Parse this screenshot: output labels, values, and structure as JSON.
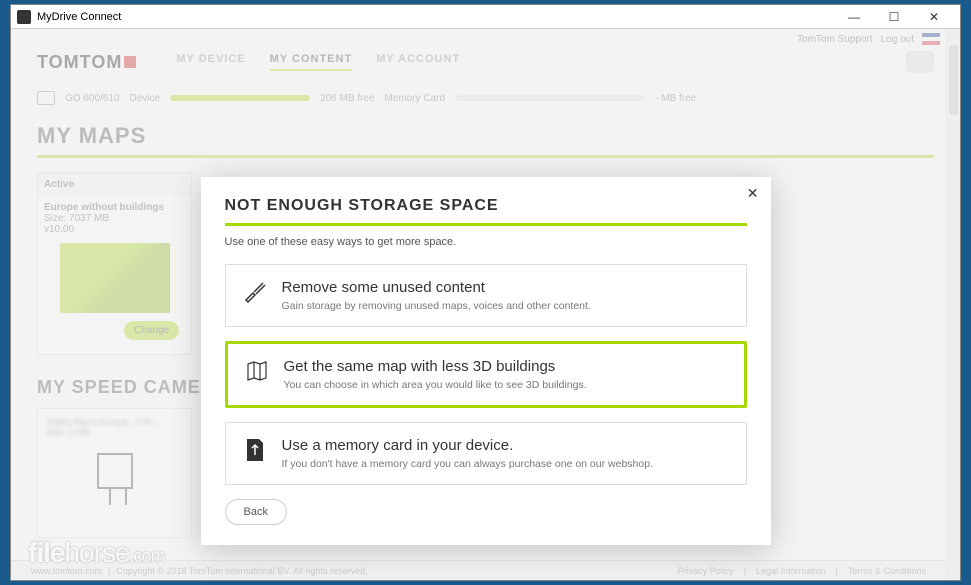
{
  "window": {
    "title": "MyDrive Connect"
  },
  "topright": {
    "support": "TomTom Support",
    "logout": "Log out"
  },
  "logo": "TOMTOM",
  "nav": {
    "device": "MY DEVICE",
    "content": "MY CONTENT",
    "account": "MY ACCOUNT"
  },
  "storage": {
    "device_name": "GO 600/610",
    "device_label": "Device",
    "free": "206 MB  free",
    "memcard": "Memory Card",
    "memfree": "- MB  free"
  },
  "maps": {
    "title": "MY MAPS",
    "card": {
      "status": "Active",
      "name": "Europe without buildings",
      "size": "Size: 7037 MB",
      "version": "v10.00",
      "change": "Change"
    }
  },
  "speed": {
    "title": "MY SPEED CAMERAS",
    "blur1": "Safety Alerts Europe - 3 M...",
    "blur2": "Size: 1 MB"
  },
  "modal": {
    "title": "NOT ENOUGH STORAGE SPACE",
    "subtitle": "Use one of these easy ways to get more space.",
    "opt1": {
      "title": "Remove some unused content",
      "desc": "Gain storage by removing unused maps, voices and other content."
    },
    "opt2": {
      "title": "Get the same map with less 3D buildings",
      "desc": "You can choose in which area you would like to see 3D buildings."
    },
    "opt3": {
      "title": "Use a memory card in your device.",
      "desc": "If you don't have a memory card you can always purchase one on our webshop."
    },
    "back": "Back"
  },
  "footer": {
    "url": "www.tomtom.com",
    "copyright": "Copyright © 2018 TomTom International BV. All rights reserved.",
    "privacy": "Privacy Policy",
    "legal": "Legal Information",
    "terms": "Terms & Conditions"
  },
  "watermark": {
    "a": "file",
    "b": "horse",
    "c": ".com"
  }
}
